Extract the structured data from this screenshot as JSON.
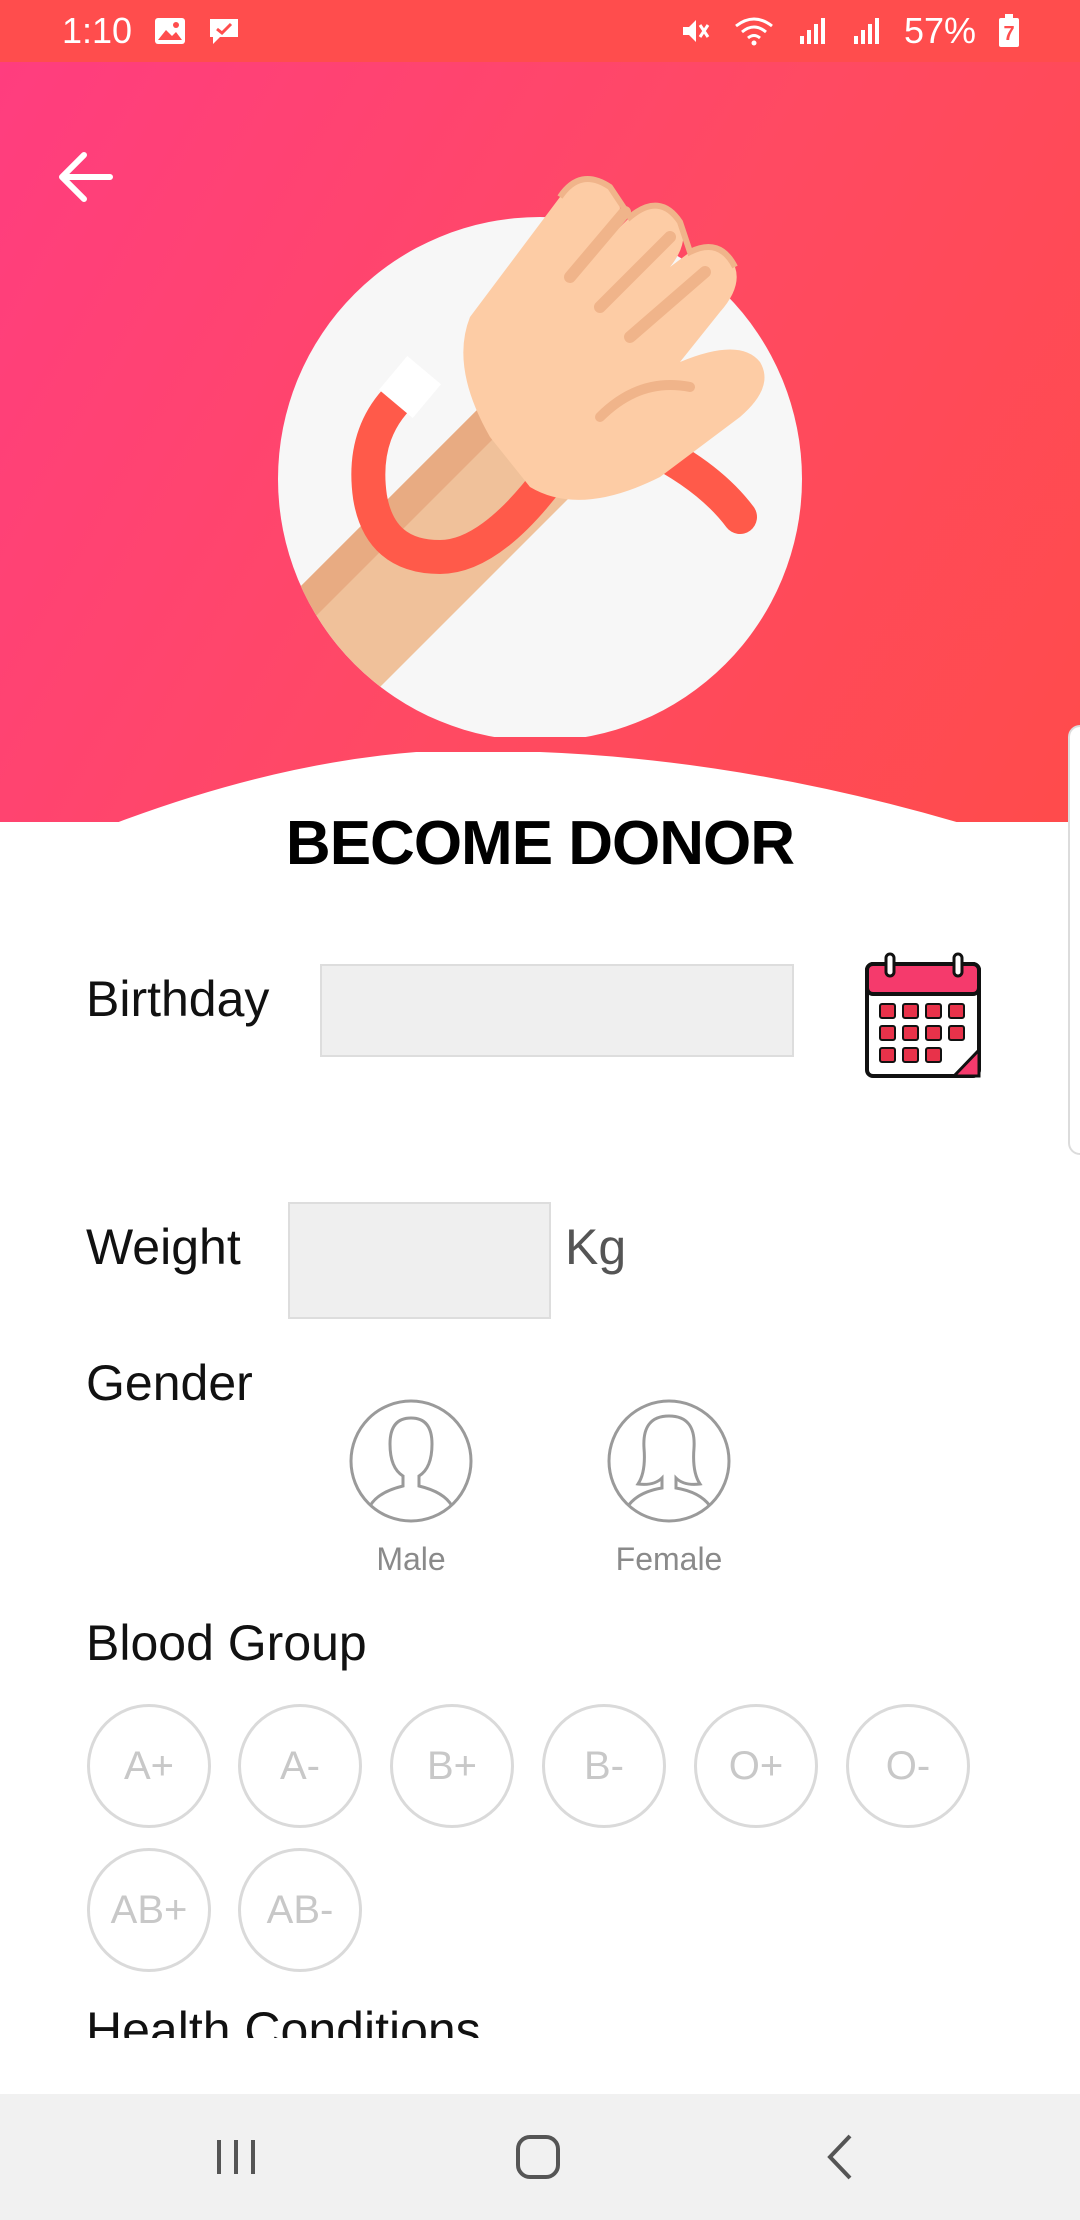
{
  "status_bar": {
    "time": "1:10",
    "battery": "57%",
    "battery_level": "7",
    "icons": [
      "image-icon",
      "message-icon",
      "mute-icon",
      "wifi-icon",
      "signal-icon",
      "signal-icon",
      "battery-icon"
    ]
  },
  "header": {
    "back_icon": "arrow-left-icon",
    "hero_image": "hand-blood-donation-illustration"
  },
  "title": "BECOME DONOR",
  "form": {
    "birthday": {
      "label": "Birthday",
      "value": "",
      "icon": "calendar-icon"
    },
    "weight": {
      "label": "Weight",
      "value": "",
      "unit": "Kg"
    },
    "gender": {
      "label": "Gender",
      "options": [
        {
          "label": "Male",
          "icon": "male-avatar-icon"
        },
        {
          "label": "Female",
          "icon": "female-avatar-icon"
        }
      ]
    },
    "blood_group": {
      "label": "Blood Group",
      "options": [
        "A+",
        "A-",
        "B+",
        "B-",
        "O+",
        "O-",
        "AB+",
        "AB-"
      ]
    },
    "health_conditions": {
      "label": "Health Conditions"
    }
  },
  "nav_bar": {
    "buttons": [
      "recent-apps-icon",
      "home-icon",
      "back-icon"
    ]
  },
  "colors": {
    "accent": "#ff4d4d",
    "header_gradient_start": "#ff3d7f",
    "header_gradient_end": "#ff4b4b"
  }
}
